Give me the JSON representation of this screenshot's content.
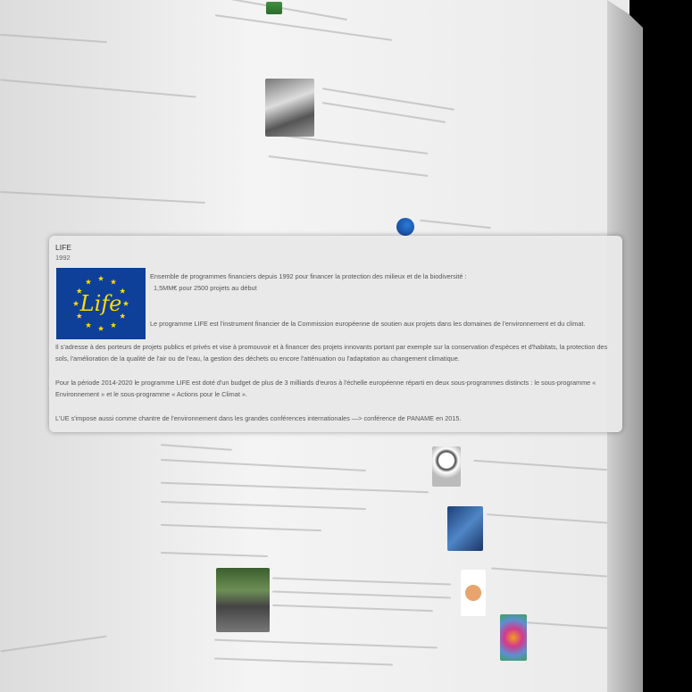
{
  "card": {
    "title": "LIFE",
    "year": "1992",
    "logo_text": "Life",
    "paragraph1_line1": "Ensemble de programmes financiers depuis 1992 pour financer la protection des milieux et de la biodiversité :",
    "paragraph1_line2": "1,5MM€ pour 2500 projets au début",
    "paragraph2": "Le programme LIFE est l'instrument financier de la Commission européenne de soutien aux projets dans les domaines de l'environnement et du climat.",
    "paragraph3": "Il s'adresse à des porteurs de projets publics et privés et vise à promouvoir et à financer des projets innovants portant par exemple sur la conservation d'espèces et d'habitats, la protection des sols, l'amélioration de la qualité de l'air ou de l'eau, la gestion des déchets ou encore l'atténuation ou l'adaptation au changement climatique.",
    "paragraph4": "Pour la période 2014-2020 le programme LIFE est doté d'un budget de plus de 3 milliards d'euros à l'échelle européenne réparti en deux sous-programmes distincts : le sous-programme « Environnement » et le sous-programme « Actions pour le Climat ».",
    "paragraph5": "L'UE s'impose aussi comme chantre de l'environnement dans les grandes conférences internationales —> conférence de PANAME en 2015."
  },
  "colors": {
    "eu_blue": "#0e3f99",
    "eu_star_yellow": "#ffdd00",
    "card_bg": "#e8e8e8"
  }
}
